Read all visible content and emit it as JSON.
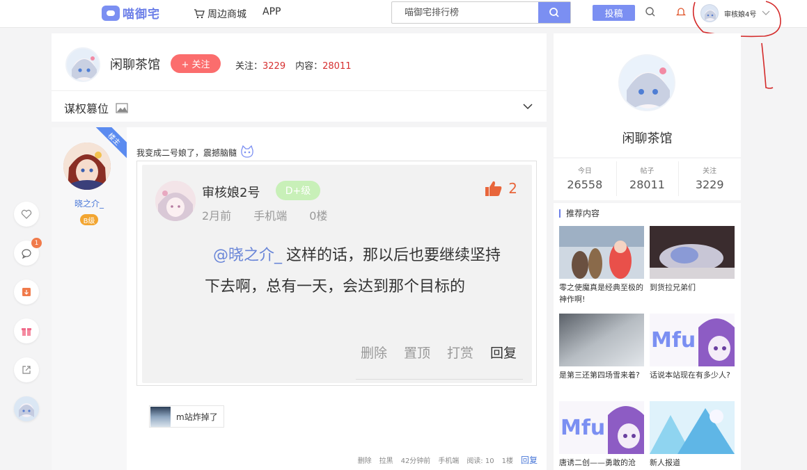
{
  "nav": {
    "logo_text": "喵御宅",
    "shop_label": "周边商城",
    "app_label": "APP",
    "search_placeholder": "喵御宅排行榜",
    "post_label": "投稿",
    "username": "审核娘4号"
  },
  "forum": {
    "title": "闲聊茶馆",
    "follow_label": "+ 关注",
    "follow_count_label": "关注：",
    "follow_count": "3229",
    "content_count_label": "内容：",
    "content_count": "28011",
    "thread_title": "谋权篡位"
  },
  "floatbar": {
    "comment_badge": "1"
  },
  "post": {
    "corner_tag": "楼主",
    "author_name": "晓之介_",
    "author_level": "B级",
    "text": "我变成二号娘了，震撼脑髓",
    "quote": {
      "name": "审核娘2号",
      "level": "D+级",
      "likes": "2",
      "time": "2月前",
      "device": "手机端",
      "floor": "0楼",
      "mention": "@晓之介_",
      "body": "这样的话，那以后也要继续坚持下去啊，总有一天，会达到那个目标的",
      "actions": [
        "删除",
        "置顶",
        "打赏",
        "回复"
      ]
    },
    "sub_reply": "m站炸掉了",
    "footer": {
      "delete": "删除",
      "block": "拉黑",
      "time": "42分钟前",
      "device": "手机端",
      "views_label": "阅读:",
      "views": "10",
      "floor": "1楼",
      "reply": "回复"
    }
  },
  "sidebar": {
    "title": "闲聊茶馆",
    "stats": [
      {
        "label": "今日",
        "value": "26558"
      },
      {
        "label": "帖子",
        "value": "28011"
      },
      {
        "label": "关注",
        "value": "3229"
      }
    ],
    "rec_title": "推荐内容",
    "rec_items": [
      {
        "caption": "零之使魔真是经典至极的神作啊!"
      },
      {
        "caption": "到货拉兄弟们"
      },
      {
        "caption": "是第三还第四场雪来着?"
      },
      {
        "caption": "话说本站现在有多少人?"
      },
      {
        "caption": "唐诱二创——勇敢的沧"
      },
      {
        "caption": "新人报道"
      }
    ]
  },
  "colors": {
    "accent": "#7b8ff2",
    "follow_red": "#fb6d6d",
    "count_red": "#d62f2f",
    "link_blue": "#4a78d8"
  }
}
